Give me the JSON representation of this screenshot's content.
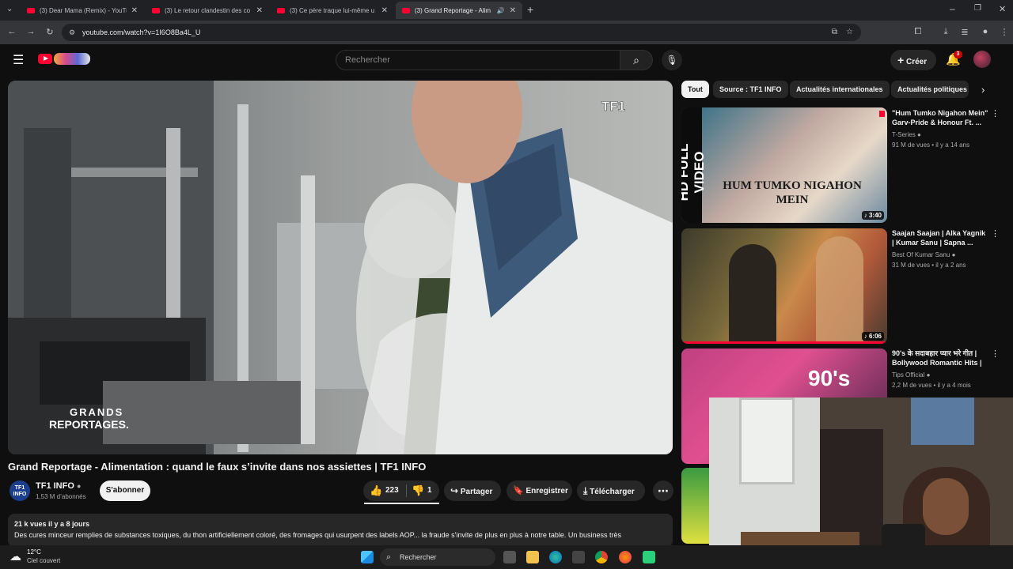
{
  "browser": {
    "tabs": [
      {
        "title": "(3) Dear Mama (Remix) - YouTu"
      },
      {
        "title": "(3) Le retour clandestin des co"
      },
      {
        "title": "(3) Ce père traque lui-même u"
      },
      {
        "title": "(3) Grand Reportage - Alim",
        "active": true
      }
    ],
    "url": "youtube.com/watch?v=1I6O8Ba4L_U"
  },
  "header": {
    "search_placeholder": "Rechercher",
    "create_label": "Créer",
    "notif_count": "3"
  },
  "video": {
    "watermark_channel": "TF1",
    "watermark_show_line1": "GRANDS",
    "watermark_show_line2": "REPORTAGES.",
    "title": "Grand Reportage - Alimentation : quand le faux s’invite dans nos assiettes | TF1 INFO",
    "channel_name": "TF1 INFO",
    "channel_avatar_text": "TF1\nINFO",
    "subscribers": "1,53 M d’abonnés",
    "subscribe_label": "S'abonner",
    "likes": "223",
    "dislikes": "1",
    "share_label": "Partager",
    "save_label": "Enregistrer",
    "download_label": "Télécharger",
    "views_date": "21 k vues  il y a 8 jours",
    "description": "Des cures minceur remplies de substances toxiques, du thon artificiellement coloré, des fromages qui usurpent des labels AOP... la fraude s'invite de plus en plus à notre table. Un business très"
  },
  "sidebar": {
    "chips": [
      "Tout",
      "Source : TF1 INFO",
      "Actualités internationales",
      "Actualités politiques"
    ],
    "items": [
      {
        "title": "\"Hum Tumko Nigahon Mein\" Garv-Pride & Honour Ft. ...",
        "channel": "T-Series",
        "meta": "91 M de vues • il y a 14 ans",
        "duration": "3:40",
        "thumb_text": "HUM TUMKO NIGAHON MEIN",
        "side_text": "HD FULL VIDEO"
      },
      {
        "title": "Saajan Saajan | Alka Yagnik | Kumar Sanu | Sapna ...",
        "channel": "Best Of Kumar Sanu",
        "meta": "31 M de vues • il y a 2 ans",
        "duration": "6:06"
      },
      {
        "title": "90's के सदाबहार प्यार भरे गीत | Bollywood Romantic Hits | ...",
        "channel": "Tips Official",
        "meta": "2,2 M de vues • il y a 4 mois",
        "duration": "",
        "thumb_text": "90's"
      }
    ]
  },
  "taskbar": {
    "temperature": "12°C",
    "weather": "Ciel couvert",
    "search_label": "Rechercher"
  },
  "colors": {
    "accent": "#ff0033",
    "bg": "#0f0f0f",
    "chip": "#272727"
  }
}
